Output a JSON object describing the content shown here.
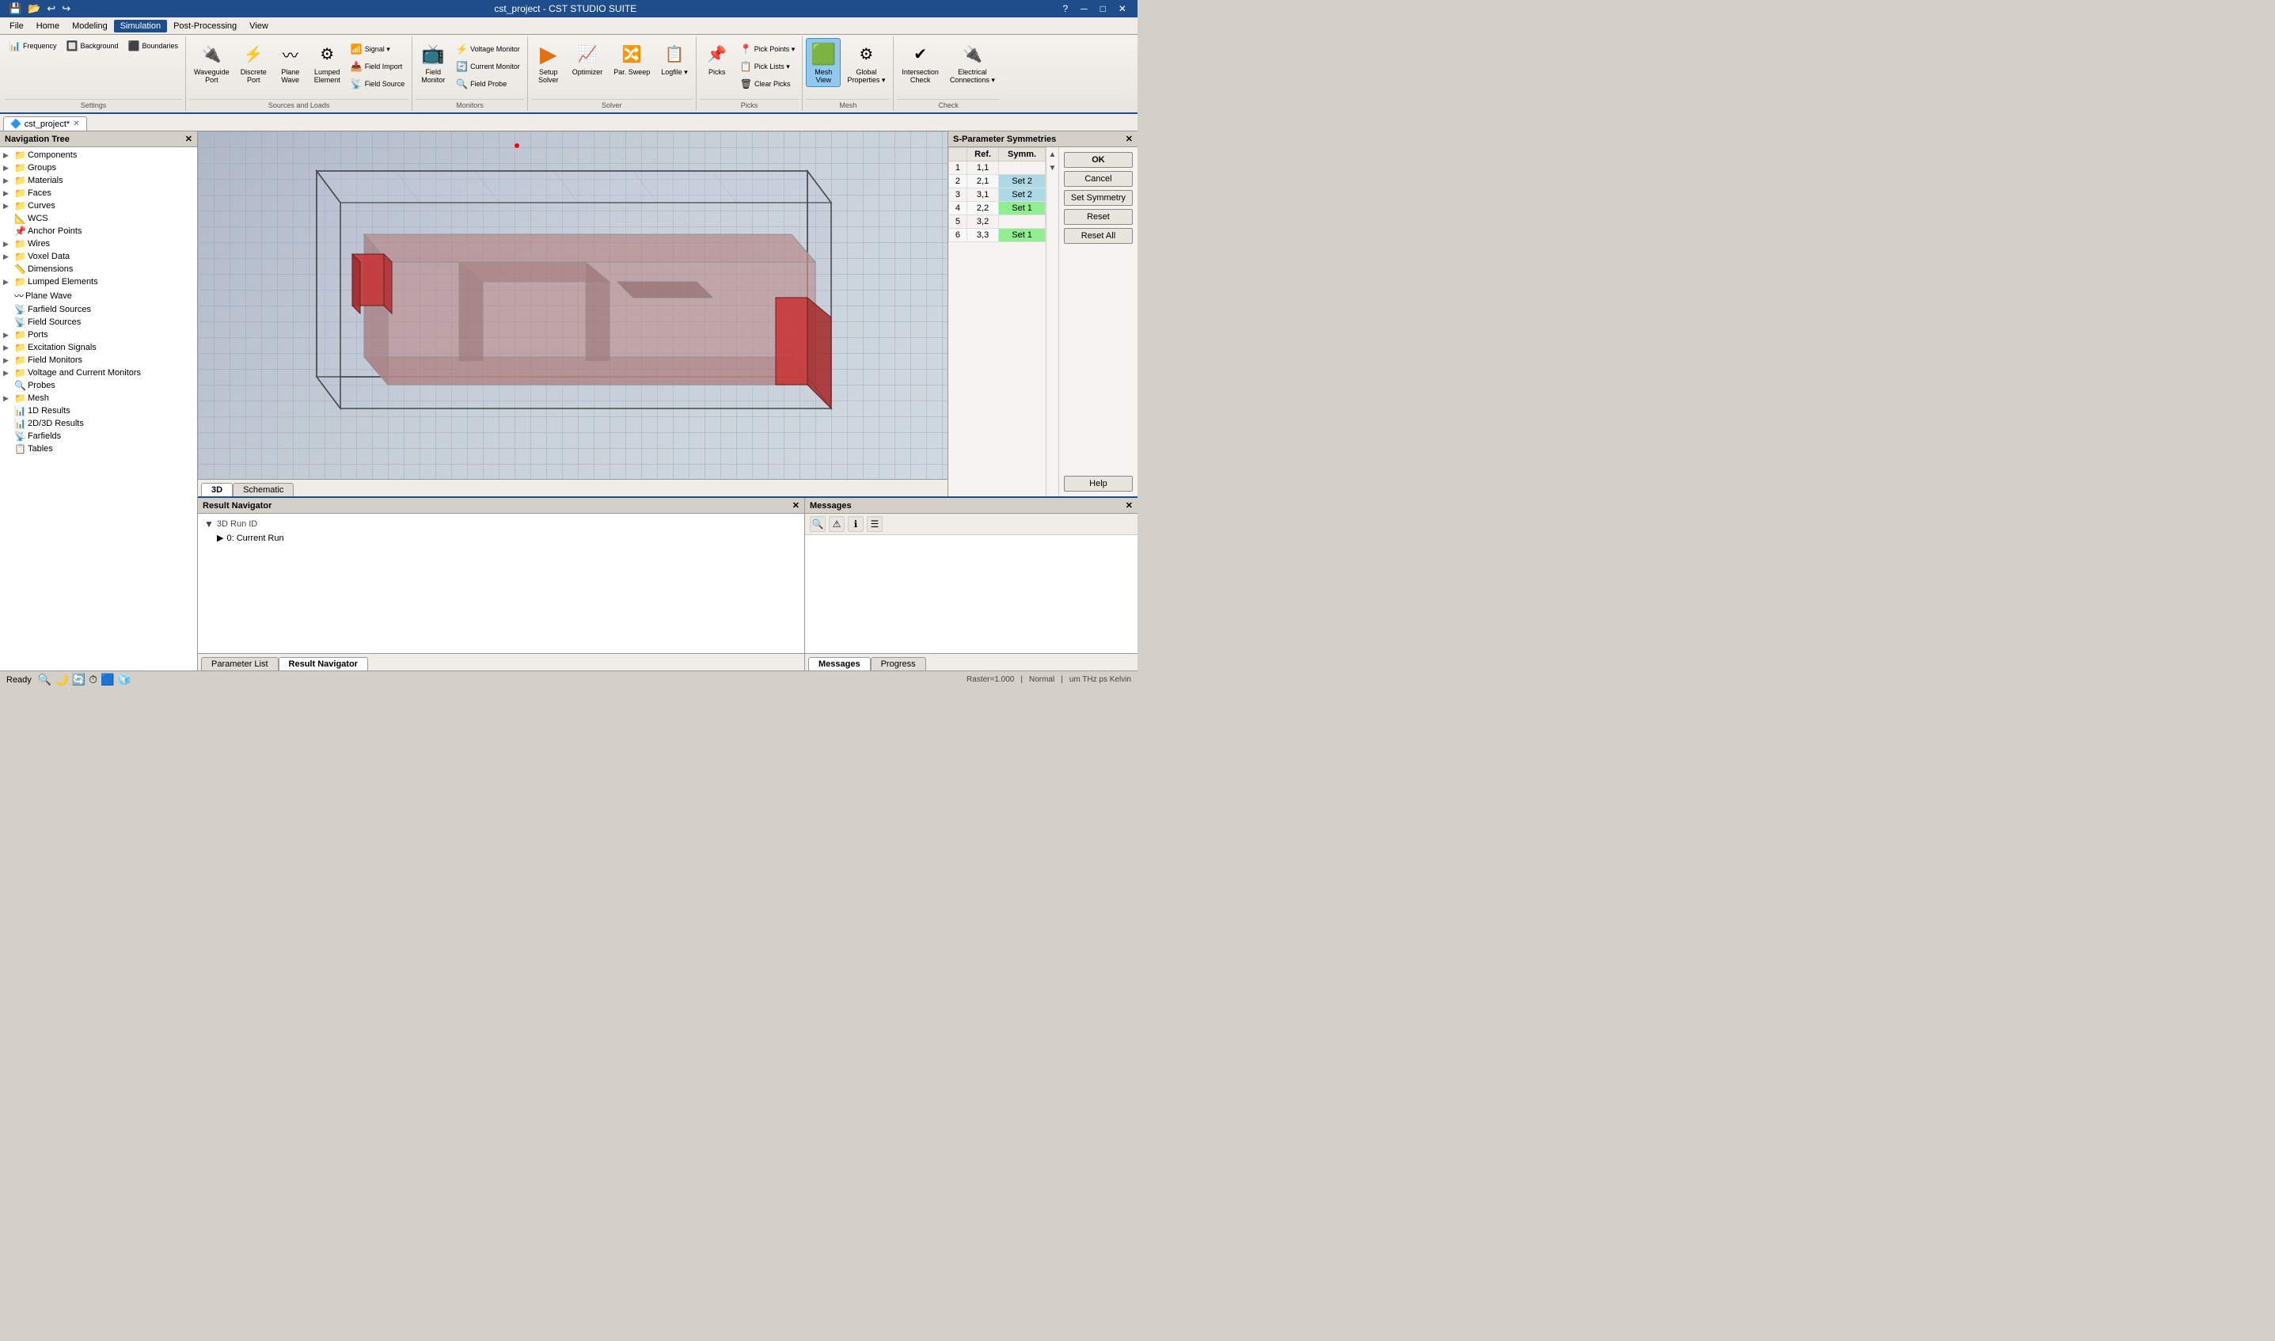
{
  "app": {
    "title": "cst_project - CST STUDIO SUITE",
    "ready_text": "Ready"
  },
  "titlebar": {
    "minimize": "─",
    "restore": "□",
    "close": "✕",
    "quick_access": [
      "💾",
      "📂",
      "↩",
      "↪"
    ]
  },
  "menubar": {
    "items": [
      "File",
      "Home",
      "Modeling",
      "Simulation",
      "Post-Processing",
      "View"
    ],
    "active": "Simulation"
  },
  "ribbon": {
    "groups": [
      {
        "name": "Settings",
        "label": "Settings",
        "items_small": [
          {
            "label": "Frequency",
            "icon": "📊"
          },
          {
            "label": "Background",
            "icon": "🔲"
          },
          {
            "label": "Boundaries",
            "icon": "⬛"
          }
        ]
      },
      {
        "name": "Sources and Loads",
        "label": "Sources and Loads",
        "items_large": [
          {
            "label": "Waveguide Port",
            "icon": "🔌"
          },
          {
            "label": "Discrete Port",
            "icon": "⚡"
          },
          {
            "label": "Plane Wave",
            "icon": "〰"
          },
          {
            "label": "Lumped Element",
            "icon": "⚙"
          }
        ],
        "items_small": [
          {
            "label": "Signal ▾",
            "icon": "📶"
          },
          {
            "label": "Field Import",
            "icon": "📥"
          },
          {
            "label": "Field Source",
            "icon": "📡"
          }
        ]
      },
      {
        "name": "Monitors",
        "label": "Monitors",
        "items_large": [
          {
            "label": "Field Monitor",
            "icon": "📺"
          }
        ],
        "items_small": [
          {
            "label": "Voltage Monitor",
            "icon": "⚡"
          },
          {
            "label": "Current Monitor",
            "icon": "🔄"
          },
          {
            "label": "Field Probe",
            "icon": "🔍"
          }
        ]
      },
      {
        "name": "Solver",
        "label": "Solver",
        "items_large": [
          {
            "label": "Setup Solver",
            "icon": "▶"
          },
          {
            "label": "Optimizer",
            "icon": "📈"
          },
          {
            "label": "Par. Sweep",
            "icon": "🔀"
          },
          {
            "label": "Logfile ▾",
            "icon": "📋"
          }
        ]
      },
      {
        "name": "Picks",
        "label": "Picks",
        "items_large": [
          {
            "label": "Picks",
            "icon": "📌"
          }
        ],
        "items_small": [
          {
            "label": "Pick Points ▾",
            "icon": "📍"
          },
          {
            "label": "Pick Lists ▾",
            "icon": "📋"
          },
          {
            "label": "Clear Picks",
            "icon": "🗑"
          }
        ]
      },
      {
        "name": "Mesh",
        "label": "Mesh",
        "items_large": [
          {
            "label": "Mesh View",
            "icon": "⬛"
          },
          {
            "label": "Global Properties ▾",
            "icon": "⚙"
          }
        ]
      },
      {
        "name": "Check",
        "label": "Check",
        "items_large": [
          {
            "label": "Intersection Check",
            "icon": "✔"
          },
          {
            "label": "Electrical Connections ▾",
            "icon": "🔌"
          }
        ]
      }
    ]
  },
  "tabs": {
    "documents": [
      {
        "label": "cst_project*",
        "icon": "🔷",
        "active": true
      }
    ]
  },
  "nav_tree": {
    "title": "Navigation Tree",
    "items": [
      {
        "label": "Components",
        "level": 0,
        "icon": "📁",
        "expandable": true
      },
      {
        "label": "Groups",
        "level": 0,
        "icon": "📁",
        "expandable": true
      },
      {
        "label": "Materials",
        "level": 0,
        "icon": "📁",
        "expandable": true
      },
      {
        "label": "Faces",
        "level": 0,
        "icon": "📁",
        "expandable": true
      },
      {
        "label": "Curves",
        "level": 0,
        "icon": "📁",
        "expandable": true
      },
      {
        "label": "WCS",
        "level": 0,
        "icon": "📐",
        "expandable": false
      },
      {
        "label": "Anchor Points",
        "level": 0,
        "icon": "📌",
        "expandable": false
      },
      {
        "label": "Wires",
        "level": 0,
        "icon": "📁",
        "expandable": true
      },
      {
        "label": "Voxel Data",
        "level": 0,
        "icon": "📁",
        "expandable": true
      },
      {
        "label": "Dimensions",
        "level": 0,
        "icon": "📏",
        "expandable": false
      },
      {
        "label": "Lumped Elements",
        "level": 0,
        "icon": "📁",
        "expandable": true
      },
      {
        "label": "Plane Wave",
        "level": 0,
        "icon": "〰",
        "expandable": false
      },
      {
        "label": "Farfield Sources",
        "level": 0,
        "icon": "📡",
        "expandable": false
      },
      {
        "label": "Field Sources",
        "level": 0,
        "icon": "📡",
        "expandable": false
      },
      {
        "label": "Ports",
        "level": 0,
        "icon": "📁",
        "expandable": true
      },
      {
        "label": "Excitation Signals",
        "level": 0,
        "icon": "📁",
        "expandable": true
      },
      {
        "label": "Field Monitors",
        "level": 0,
        "icon": "📁",
        "expandable": true
      },
      {
        "label": "Voltage and Current Monitors",
        "level": 0,
        "icon": "📁",
        "expandable": true
      },
      {
        "label": "Probes",
        "level": 0,
        "icon": "🔍",
        "expandable": false
      },
      {
        "label": "Mesh",
        "level": 0,
        "icon": "📁",
        "expandable": true
      },
      {
        "label": "1D Results",
        "level": 0,
        "icon": "📊",
        "expandable": false
      },
      {
        "label": "2D/3D Results",
        "level": 0,
        "icon": "📊",
        "expandable": false
      },
      {
        "label": "Farfields",
        "level": 0,
        "icon": "📡",
        "expandable": false
      },
      {
        "label": "Tables",
        "level": 0,
        "icon": "📋",
        "expandable": false
      }
    ]
  },
  "viewport": {
    "tabs": [
      "3D",
      "Schematic"
    ],
    "active_tab": "3D"
  },
  "sparam_panel": {
    "title": "S-Parameter Symmetries",
    "col_ref": "Ref.",
    "col_symm": "Symm.",
    "rows": [
      {
        "num": 1,
        "ref": "1,1",
        "symm": ""
      },
      {
        "num": 2,
        "ref": "2,1",
        "symm": "Set 2",
        "symm_class": "set2"
      },
      {
        "num": 3,
        "ref": "3,1",
        "symm": "Set 2",
        "symm_class": "set2"
      },
      {
        "num": 4,
        "ref": "2,2",
        "symm": "Set 1",
        "symm_class": "set1"
      },
      {
        "num": 5,
        "ref": "3,2",
        "symm": ""
      },
      {
        "num": 6,
        "ref": "3,3",
        "symm": "Set 1",
        "symm_class": "set1"
      }
    ],
    "buttons": [
      "OK",
      "Cancel",
      "Set Symmetry",
      "Reset",
      "Reset All",
      "Help"
    ]
  },
  "bottom_panel": {
    "title": "Result Navigator",
    "close_btn": "✕",
    "filter_label": "3D Run ID",
    "run_item": "0: Current Run",
    "tabs": [
      "Parameter List",
      "Result Navigator"
    ]
  },
  "messages_panel": {
    "title": "Messages",
    "toolbar_btns": [
      "🔍",
      "⚠",
      "ℹ",
      "☰"
    ],
    "panel_tabs": [
      "Messages",
      "Progress"
    ]
  },
  "status_bar": {
    "text": "Ready",
    "raster": "Raster=1.000",
    "normal": "Normal",
    "units": "um THz ps Kelvin"
  }
}
